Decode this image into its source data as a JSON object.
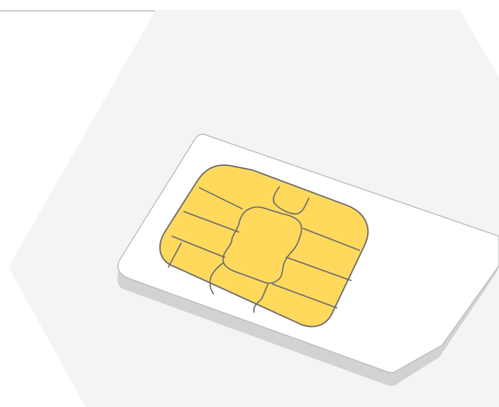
{
  "illustration": {
    "subject": "sim-card-icon",
    "colors": {
      "page_background": "#ffffff",
      "hexagon_background": "#f4f4f4",
      "card_face": "#ffffff",
      "card_edge": "#d2d2d2",
      "card_outline": "#bdbdbd",
      "chip_fill": "#ffd95c",
      "chip_outline": "#6e6e6e",
      "divider_line": "#9a9a9a"
    }
  }
}
